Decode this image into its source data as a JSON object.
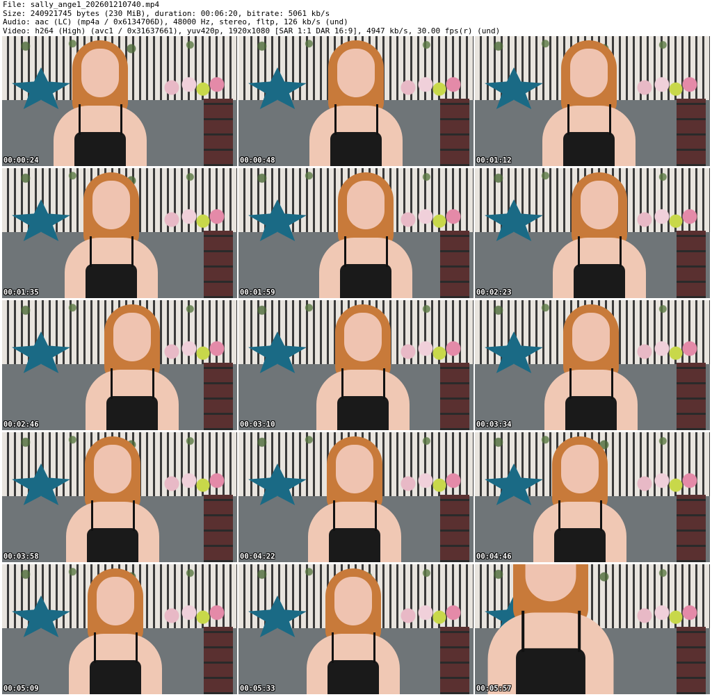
{
  "header": {
    "line1": "File: sally_ange1_202601210740.mp4",
    "line2": "Size: 240921745 bytes (230 MiB), duration: 00:06:20, bitrate: 5061 kb/s",
    "line3": "Audio: aac (LC) (mp4a / 0x6134706D), 48000 Hz, stereo, fltp, 126 kb/s (und)",
    "line4": "Video: h264 (High) (avc1 / 0x31637661), yuv420p, 1920x1080 [SAR 1:1 DAR 16:9], 4947 kb/s, 30.00 fps(r) (und)"
  },
  "frames": [
    {
      "timestamp": "00:00:24"
    },
    {
      "timestamp": "00:00:48"
    },
    {
      "timestamp": "00:01:12"
    },
    {
      "timestamp": "00:01:35"
    },
    {
      "timestamp": "00:01:59"
    },
    {
      "timestamp": "00:02:23"
    },
    {
      "timestamp": "00:02:46"
    },
    {
      "timestamp": "00:03:10"
    },
    {
      "timestamp": "00:03:34"
    },
    {
      "timestamp": "00:03:58"
    },
    {
      "timestamp": "00:04:22"
    },
    {
      "timestamp": "00:04:46"
    },
    {
      "timestamp": "00:05:09"
    },
    {
      "timestamp": "00:05:33"
    },
    {
      "timestamp": "00:05:57"
    }
  ]
}
